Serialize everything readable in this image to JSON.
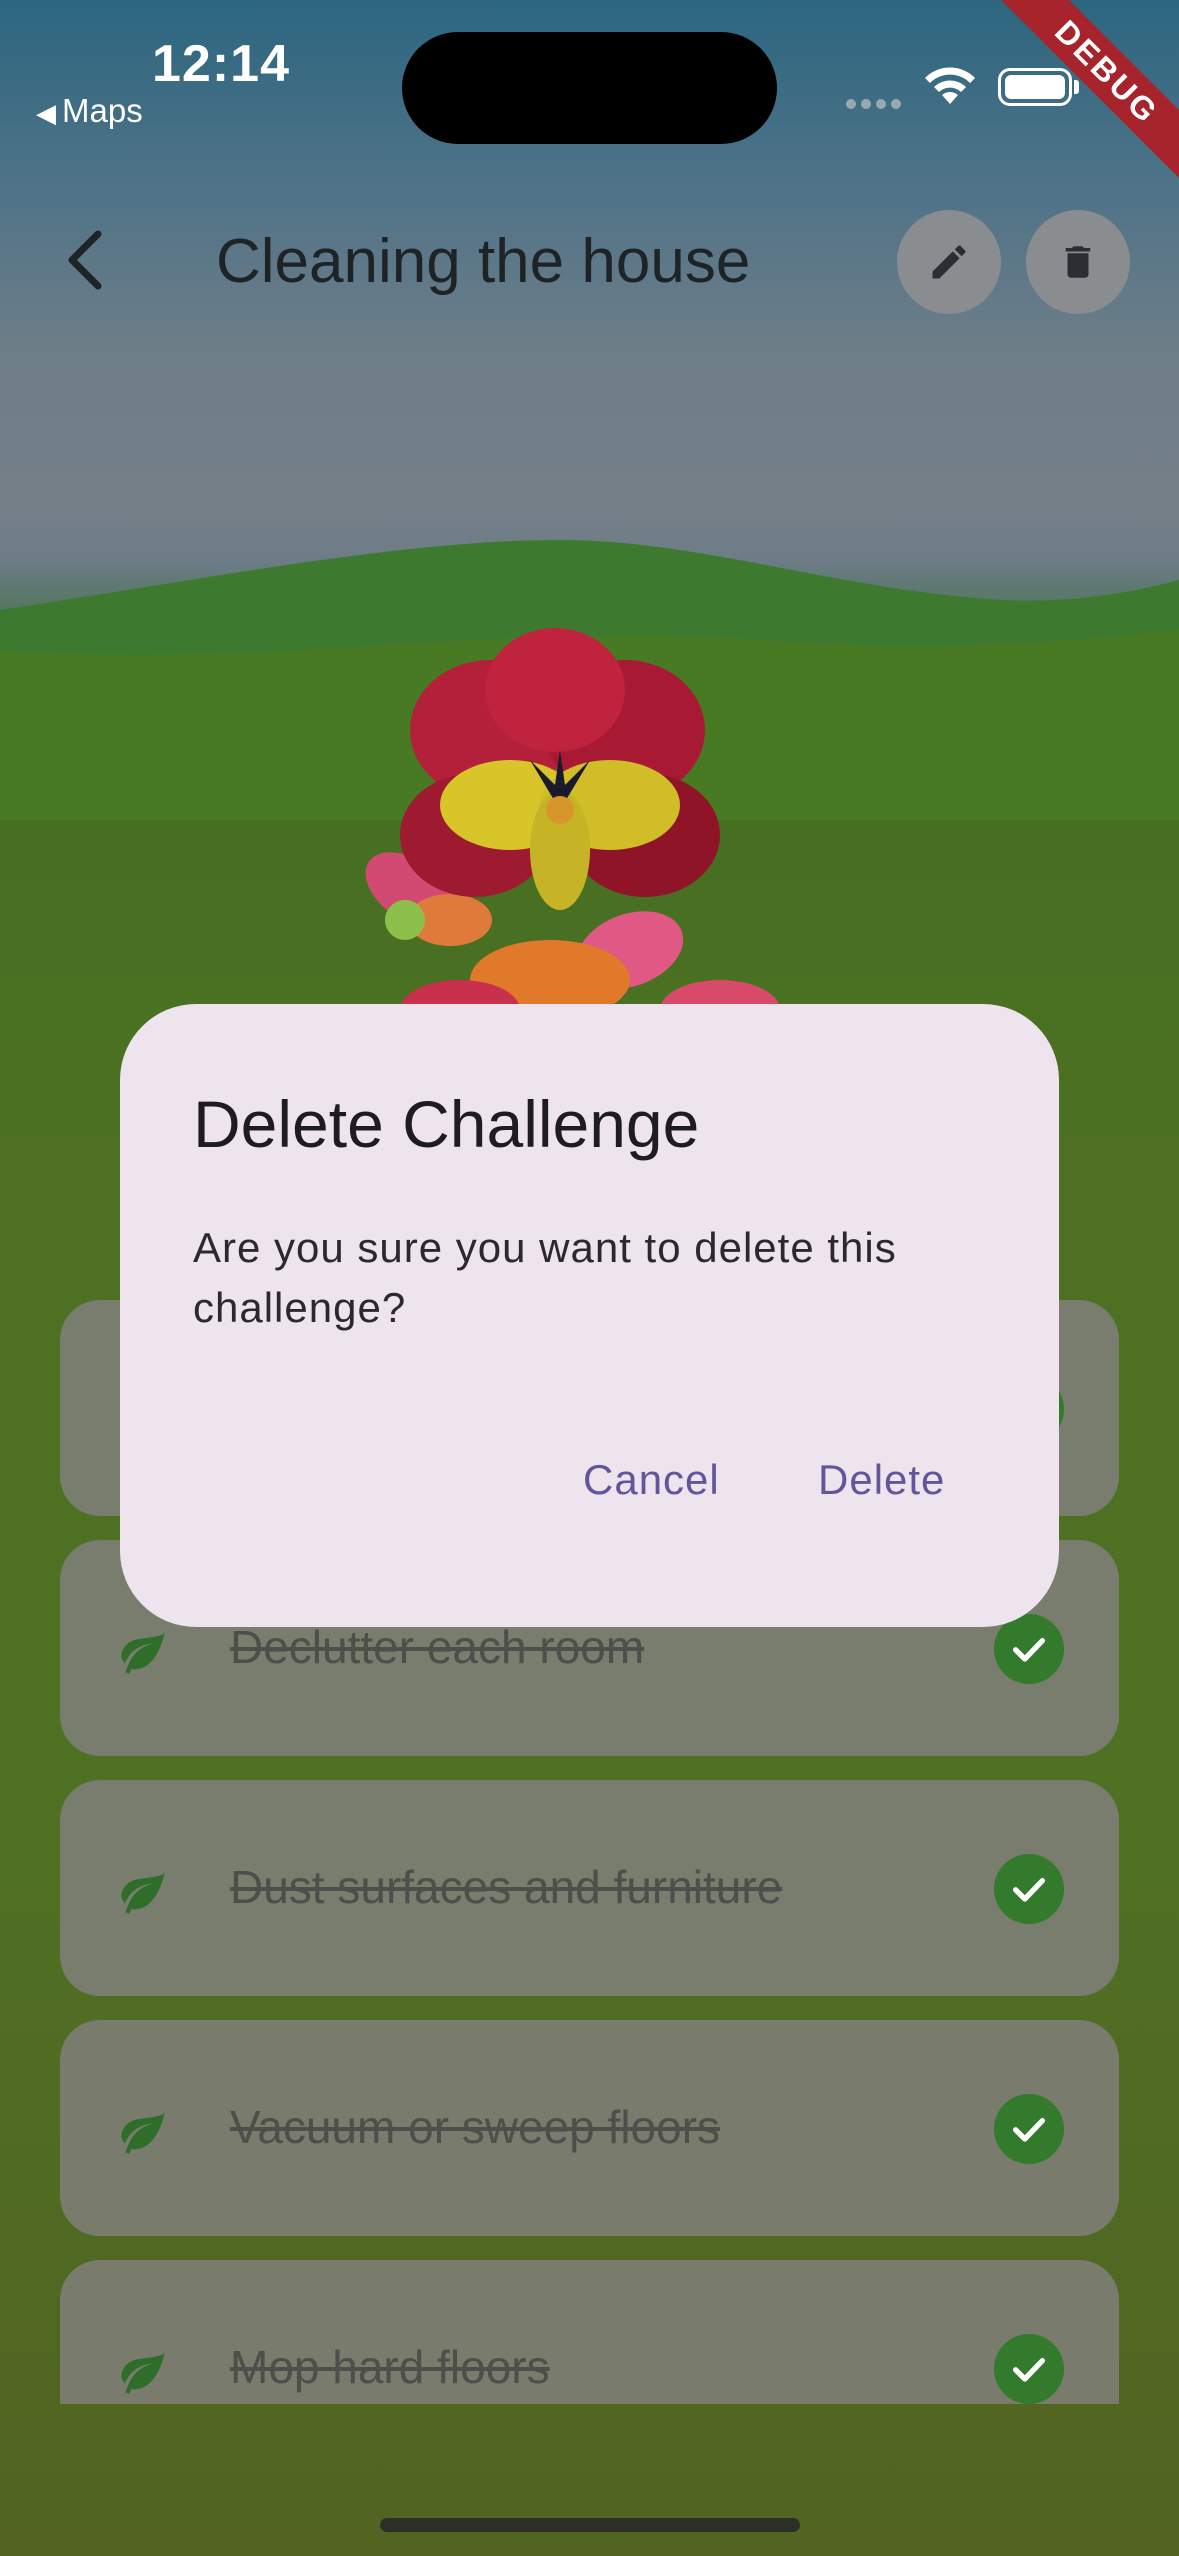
{
  "status_bar": {
    "time": "12:14",
    "back_label": "Maps",
    "debug_label": "DEBUG"
  },
  "app_bar": {
    "title": "Cleaning the house"
  },
  "tasks": [
    {
      "label": "Declutter each room",
      "completed": true
    },
    {
      "label": "Dust surfaces and furniture",
      "completed": true
    },
    {
      "label": "Vacuum or sweep floors",
      "completed": true
    },
    {
      "label": "Mop hard floors",
      "completed": true
    }
  ],
  "dialog": {
    "title": "Delete Challenge",
    "message": "Are you sure you want to delete this challenge?",
    "cancel_label": "Cancel",
    "delete_label": "Delete"
  },
  "colors": {
    "accent": "#64549a",
    "check": "#347a2c",
    "dialog_bg": "#eee4ee",
    "debug_banner": "#a8242c"
  }
}
